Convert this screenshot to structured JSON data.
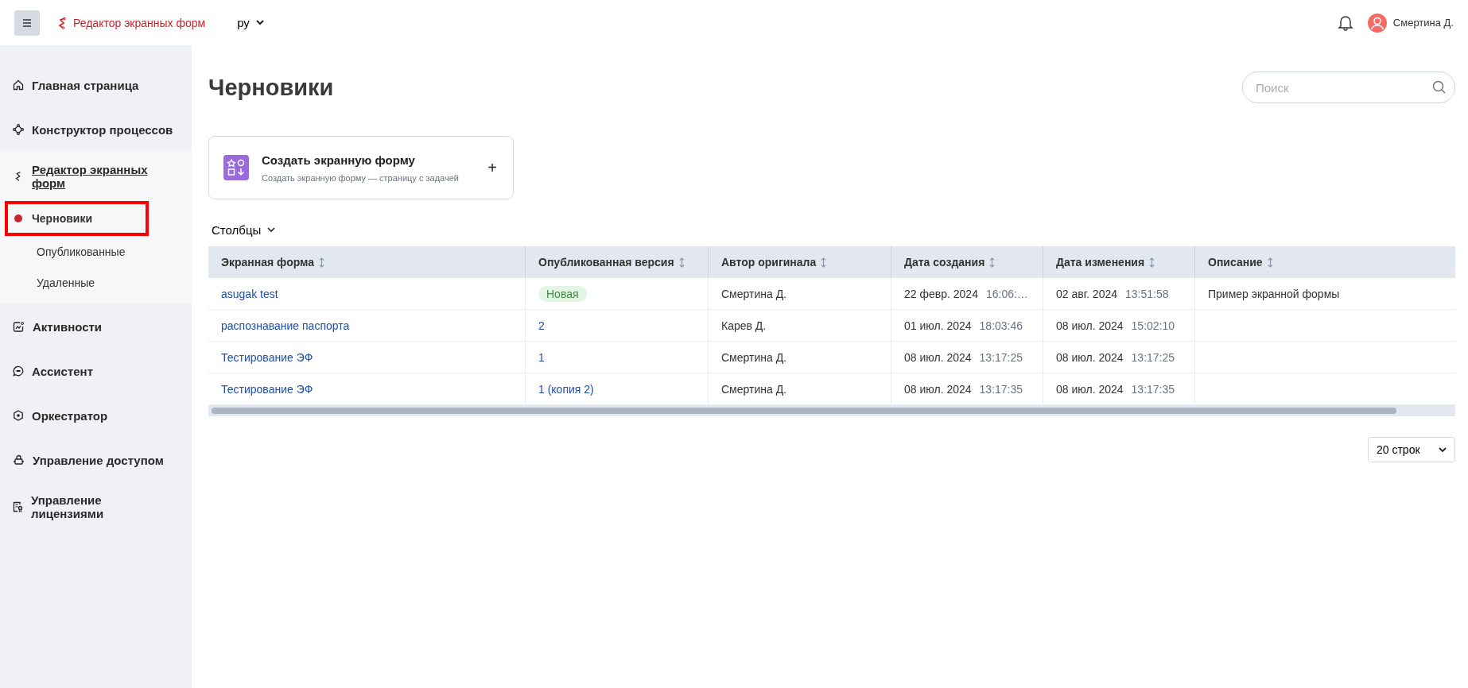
{
  "header": {
    "app_name": "Редактор экранных форм",
    "language": "ру",
    "user": "Смертина Д."
  },
  "sidebar": {
    "items": [
      {
        "label": "Главная страница",
        "selected": false
      },
      {
        "label": "Конструктор процессов",
        "selected": false
      },
      {
        "label": "Редактор экранных форм",
        "selected": true,
        "expanded": true,
        "children": [
          {
            "label": "Черновики",
            "selected": true,
            "highlighted": true
          },
          {
            "label": "Опубликованные",
            "selected": false,
            "highlighted": false
          },
          {
            "label": "Удаленные",
            "selected": false,
            "highlighted": false
          }
        ]
      },
      {
        "label": "Активности",
        "selected": false
      },
      {
        "label": "Ассистент",
        "selected": false
      },
      {
        "label": "Оркестратор",
        "selected": false
      },
      {
        "label": "Управление доступом",
        "selected": false
      },
      {
        "label": "Управление лицензиями",
        "selected": false
      }
    ]
  },
  "page": {
    "title": "Черновики",
    "search": {
      "placeholder": "Поиск"
    },
    "create_card": {
      "title": "Создать экранную форму",
      "subtitle": "Создать экранную форму — страницу с задачей",
      "action": "+"
    },
    "columns_button": "Столбцы"
  },
  "table": {
    "columns": [
      "Экранная форма",
      "Опубликованная версия",
      "Автор оригинала",
      "Дата создания",
      "Дата изменения",
      "Описание"
    ],
    "rows": [
      {
        "name": "asugak test",
        "version": {
          "kind": "badge",
          "text": "Новая"
        },
        "author": "Смертина Д.",
        "created": {
          "date": "22 февр. 2024",
          "time": "16:06:…"
        },
        "modified": {
          "date": "02 авг. 2024",
          "time": "13:51:58"
        },
        "description": "Пример экранной формы"
      },
      {
        "name": "распознавание паспорта",
        "version": {
          "kind": "link",
          "text": "2"
        },
        "author": "Карев Д.",
        "created": {
          "date": "01 июл. 2024",
          "time": "18:03:46"
        },
        "modified": {
          "date": "08 июл. 2024",
          "time": "15:02:10"
        }
      },
      {
        "name": "Тестирование ЭФ",
        "version": {
          "kind": "link",
          "text": "1"
        },
        "author": "Смертина Д.",
        "created": {
          "date": "08 июл. 2024",
          "time": "13:17:25"
        },
        "modified": {
          "date": "08 июл. 2024",
          "time": "13:17:25"
        }
      },
      {
        "name": "Тестирование ЭФ",
        "version": {
          "kind": "link",
          "text": "1 (копия 2)"
        },
        "author": "Смертина Д.",
        "created": {
          "date": "08 июл. 2024",
          "time": "13:17:35"
        },
        "modified": {
          "date": "08 июл. 2024",
          "time": "13:17:35"
        }
      }
    ]
  },
  "pagination": {
    "page_size": "20 строк"
  }
}
